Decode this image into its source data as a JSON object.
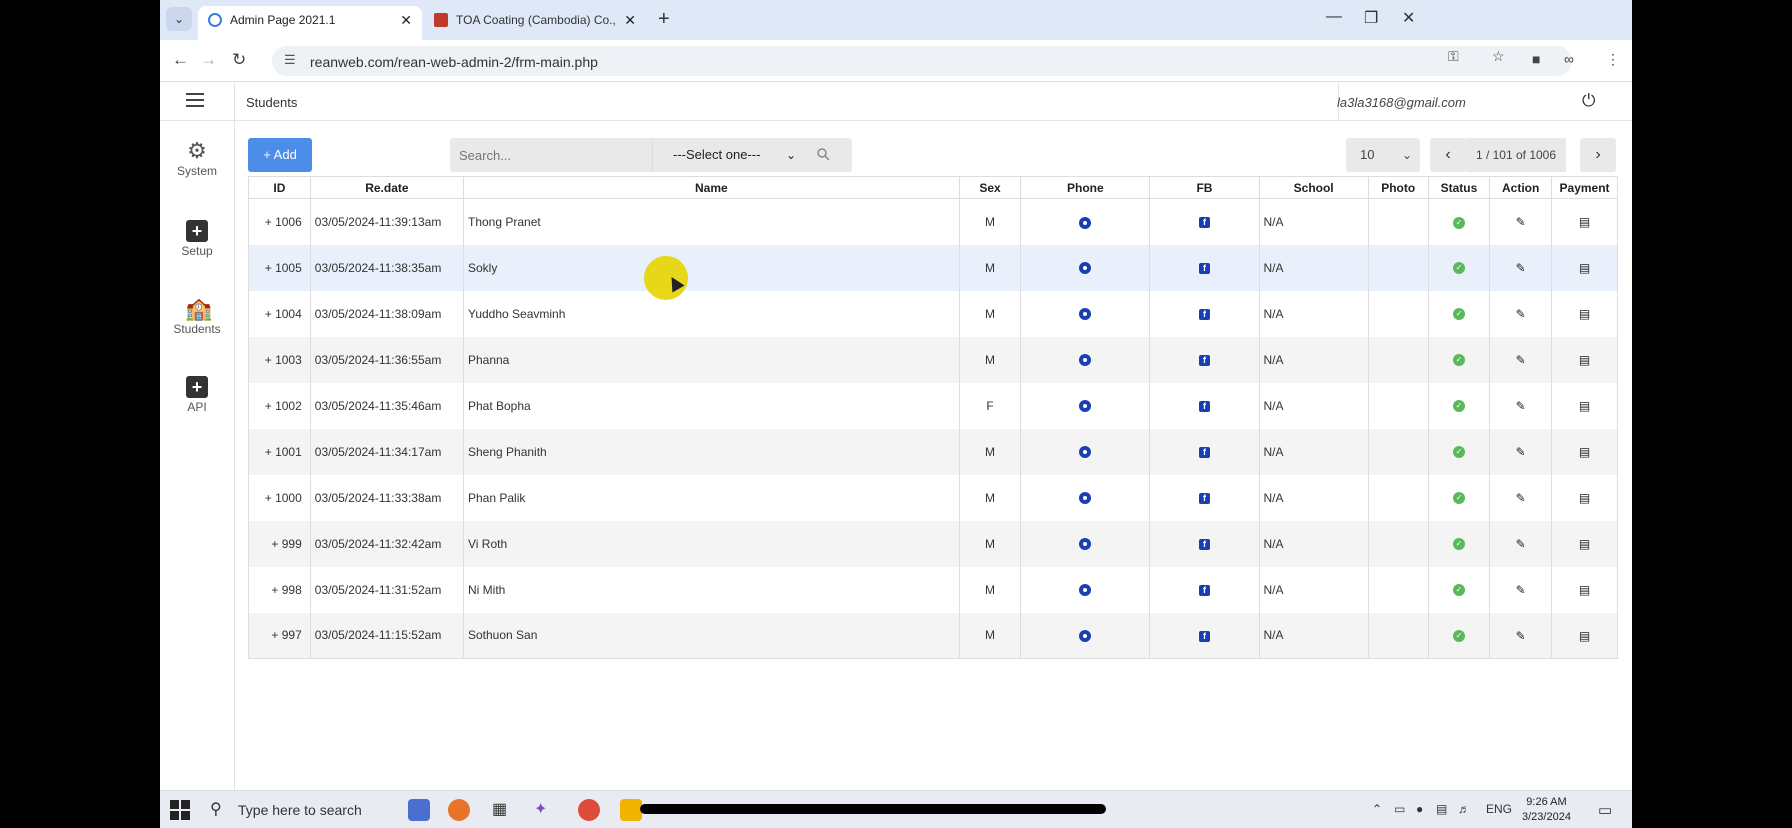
{
  "browser": {
    "tabs": [
      {
        "title": "Admin Page 2021.1",
        "active": true
      },
      {
        "title": "TOA Coating (Cambodia) Co.,Lt",
        "active": false
      }
    ],
    "url": "reanweb.com/rean-web-admin-2/frm-main.php"
  },
  "header": {
    "page_title": "Students",
    "user_email": "la3la3168@gmail.com"
  },
  "sidebar": {
    "items": [
      {
        "label": "System",
        "icon": "users-gear-icon"
      },
      {
        "label": "Setup",
        "icon": "plus-square-icon"
      },
      {
        "label": "Students",
        "icon": "school-icon"
      },
      {
        "label": "API",
        "icon": "plus-square-icon"
      }
    ]
  },
  "toolbar": {
    "add_label": "+ Add",
    "search_placeholder": "Search...",
    "select_value": "---Select one---",
    "page_size": "10",
    "page_info": "1 / 101 of 1006"
  },
  "table": {
    "columns": [
      "ID",
      "Re.date",
      "Name",
      "Sex",
      "Phone",
      "FB",
      "School",
      "Photo",
      "Status",
      "Action",
      "Payment"
    ],
    "rows": [
      {
        "id": "+ 1006",
        "date": "03/05/2024-11:39:13am",
        "name": "Thong Pranet",
        "sex": "M",
        "school": "N/A"
      },
      {
        "id": "+ 1005",
        "date": "03/05/2024-11:38:35am",
        "name": "Sokly",
        "sex": "M",
        "school": "N/A"
      },
      {
        "id": "+ 1004",
        "date": "03/05/2024-11:38:09am",
        "name": "Yuddho Seavminh",
        "sex": "M",
        "school": "N/A"
      },
      {
        "id": "+ 1003",
        "date": "03/05/2024-11:36:55am",
        "name": "Phanna",
        "sex": "M",
        "school": "N/A"
      },
      {
        "id": "+ 1002",
        "date": "03/05/2024-11:35:46am",
        "name": "Phat Bopha",
        "sex": "F",
        "school": "N/A"
      },
      {
        "id": "+ 1001",
        "date": "03/05/2024-11:34:17am",
        "name": "Sheng Phanith",
        "sex": "M",
        "school": "N/A"
      },
      {
        "id": "+ 1000",
        "date": "03/05/2024-11:33:38am",
        "name": "Phan Palik",
        "sex": "M",
        "school": "N/A"
      },
      {
        "id": "+ 999",
        "date": "03/05/2024-11:32:42am",
        "name": "Vi Roth",
        "sex": "M",
        "school": "N/A"
      },
      {
        "id": "+ 998",
        "date": "03/05/2024-11:31:52am",
        "name": "Ni Mith",
        "sex": "M",
        "school": "N/A"
      },
      {
        "id": "+ 997",
        "date": "03/05/2024-11:15:52am",
        "name": "Sothuon San",
        "sex": "M",
        "school": "N/A"
      }
    ]
  },
  "taskbar": {
    "search_placeholder": "Type here to search",
    "lang": "ENG",
    "time": "9:26 AM",
    "date": "3/23/2024"
  },
  "colors": {
    "accent": "#4b8de9",
    "status_ok": "#5cb85c",
    "icon_blue": "#1a3fb0"
  }
}
